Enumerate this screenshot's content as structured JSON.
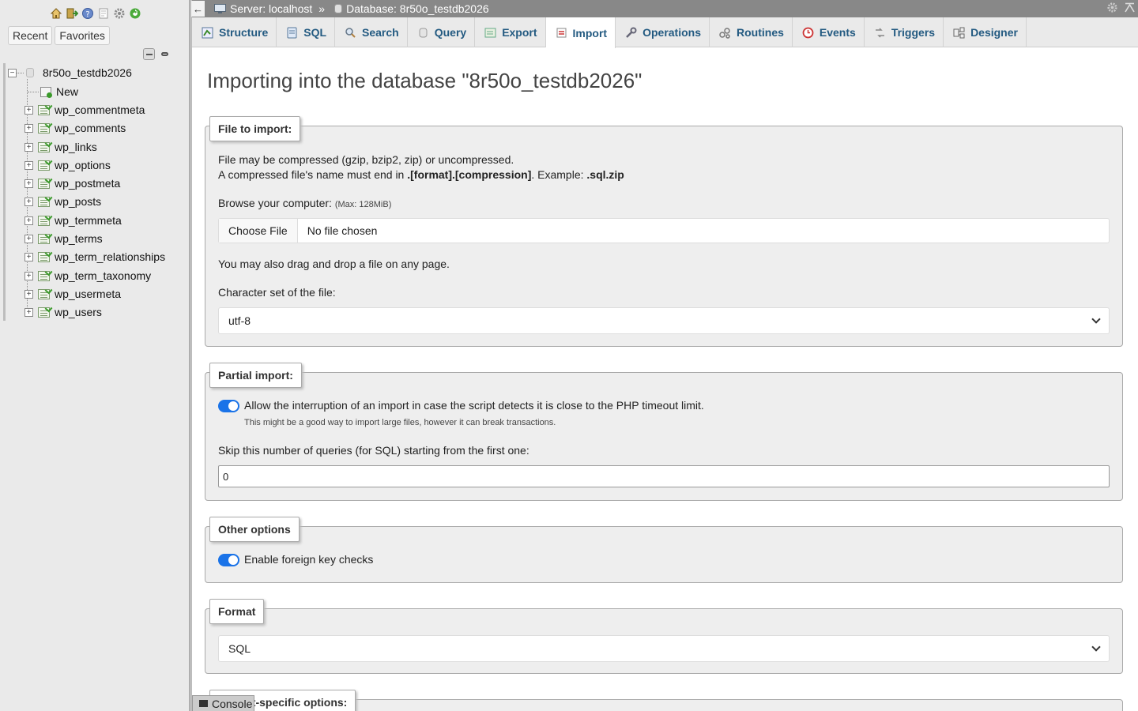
{
  "nav": {
    "tabs": [
      "Recent",
      "Favorites"
    ],
    "database": "8r50o_testdb2026",
    "new_label": "New",
    "tables": [
      "wp_commentmeta",
      "wp_comments",
      "wp_links",
      "wp_options",
      "wp_postmeta",
      "wp_posts",
      "wp_termmeta",
      "wp_terms",
      "wp_term_relationships",
      "wp_term_taxonomy",
      "wp_usermeta",
      "wp_users"
    ]
  },
  "topbar": {
    "server": "Server: localhost",
    "separator": "»",
    "database": "Database: 8r50o_testdb2026"
  },
  "tabs": [
    "Structure",
    "SQL",
    "Search",
    "Query",
    "Export",
    "Import",
    "Operations",
    "Routines",
    "Events",
    "Triggers",
    "Designer"
  ],
  "active_tab": "Import",
  "main": {
    "title": "Importing into the database \"8r50o_testdb2026\"",
    "file_import": {
      "legend": "File to import:",
      "line1": "File may be compressed (gzip, bzip2, zip) or uncompressed.",
      "line2_prefix": "A compressed file's name must end in ",
      "line2_format": ".[format].[compression]",
      "line2_mid": ". Example: ",
      "line2_example": ".sql.zip",
      "browse_label": "Browse your computer:",
      "max_size": "(Max: 128MiB)",
      "choose_file": "Choose File",
      "file_status": "No file chosen",
      "drag_drop": "You may also drag and drop a file on any page.",
      "charset_label": "Character set of the file:",
      "charset_value": "utf-8"
    },
    "partial_import": {
      "legend": "Partial import:",
      "allow_interrupt": "Allow the interruption of an import in case the script detects it is close to the PHP timeout limit.",
      "allow_interrupt_checked": true,
      "hint": "This might be a good way to import large files, however it can break transactions.",
      "skip_label": "Skip this number of queries (for SQL) starting from the first one:",
      "skip_value": "0"
    },
    "other_options": {
      "legend": "Other options",
      "foreign_keys": "Enable foreign key checks",
      "foreign_keys_checked": true
    },
    "format": {
      "legend": "Format",
      "value": "SQL"
    },
    "format_specific_legend": "Format-specific options:"
  },
  "console_label": "Console",
  "colors": {
    "accent": "#235a81",
    "toggle": "#1a73e8",
    "topbar": "#888888"
  }
}
